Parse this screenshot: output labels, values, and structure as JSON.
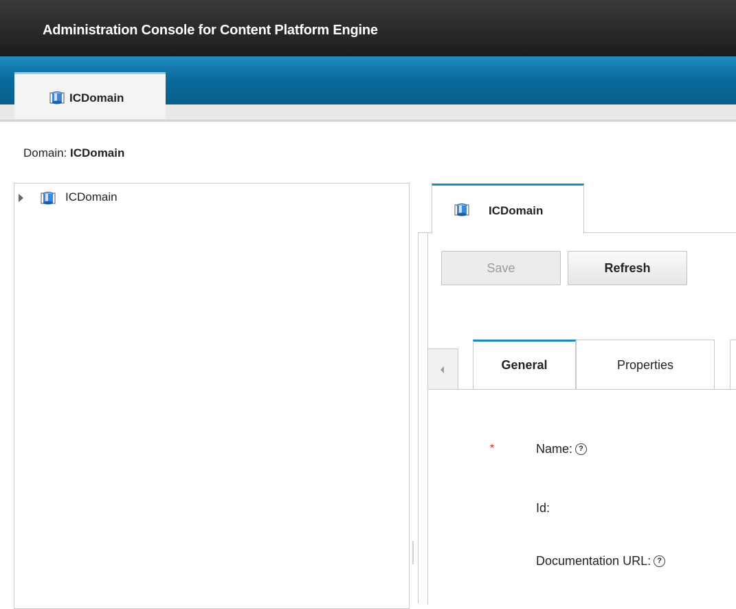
{
  "app": {
    "title": "Administration Console for Content Platform Engine"
  },
  "top_tab": {
    "label": "ICDomain",
    "icon": "domain-icon"
  },
  "breadcrumb": {
    "prefix": "Domain: ",
    "value": "ICDomain"
  },
  "tree": {
    "items": [
      {
        "label": "ICDomain",
        "icon": "domain-icon",
        "expanded": false
      }
    ]
  },
  "document_tab": {
    "label": "ICDomain",
    "icon": "domain-icon"
  },
  "toolbar": {
    "save_label": "Save",
    "refresh_label": "Refresh"
  },
  "subtabs": [
    {
      "label": "General",
      "selected": true
    },
    {
      "label": "Properties",
      "selected": false
    }
  ],
  "form": {
    "name_label": "Name:",
    "id_label": "Id:",
    "doc_url_label": "Documentation URL:",
    "help_glyph": "?",
    "required_marker": "*"
  }
}
